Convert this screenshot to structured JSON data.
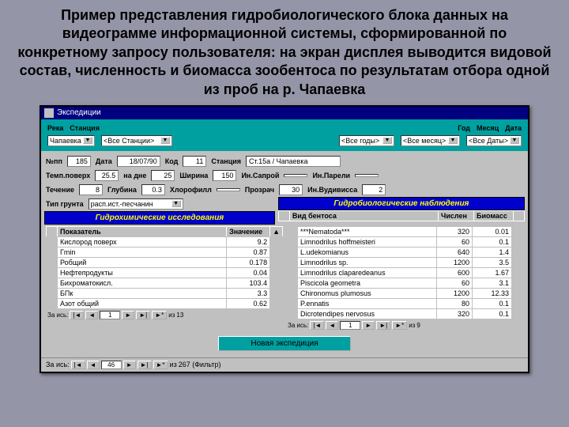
{
  "title": "Пример представления гидробиологического блока данных на видеограмме информационной системы, сформированной по конкретному запросу пользователя: на экран дисплея выводится видовой состав, численность и биомасса зообентоса по результатам отбора одной из проб на р. Чапаевка",
  "window": {
    "title": "Экспедиции"
  },
  "filters": {
    "reka_lbl": "Река",
    "reka_val": "Чапаевка",
    "stanciya_lbl": "Станция",
    "stanciya_val": "<Все Станции>",
    "god_lbl": "Год",
    "god_val": "<Все годы>",
    "mesyac_lbl": "Месяц",
    "mesyac_val": "<Все месяц>",
    "data_lbl": "Дата",
    "data_val": "<Все Даты>"
  },
  "params1": {
    "nrec_lbl": "№пп",
    "nrec": "185",
    "data_lbl": "Дата",
    "data": "18/07/90",
    "kod_lbl": "Код",
    "kod": "11",
    "stanciya_lbl": "Станция",
    "stanciya": "Ст.15а / Чапаевка"
  },
  "params2": {
    "temp_lbl": "Темп.поверх",
    "temp": "25.5",
    "nadne_lbl": "на дне",
    "nadne": "25",
    "shirina_lbl": "Ширина",
    "shirina": "150",
    "in_skoroi_lbl": "Ин.Сапрой",
    "in_sap": "",
    "in_pareli_lbl": "Ин.Парели",
    "in_par": ""
  },
  "params3": {
    "techenie_lbl": "Течение",
    "techenie": "8",
    "glubina_lbl": "Глубина",
    "glubina": "0.3",
    "chlorofill_lbl": "Хлорофилл",
    "chlor": "",
    "prozrach_lbl": "Прозрач",
    "prozrach": "30",
    "in_vud_lbl": "Ин.Вудивисса",
    "in_vud": "2"
  },
  "grunt": {
    "lbl": "Тип грунта",
    "val": "расп.ист.-песчанин"
  },
  "hydro": {
    "hdr_left": "Гидрохимические исследования",
    "hdr_right": "Гидробиологические наблюдения",
    "species_col": "Вид бентоса",
    "count_col": "Числен",
    "biomass_col": "Биомасс"
  },
  "left_table": {
    "col1": "Показатель",
    "col2": "Значение",
    "rows": [
      {
        "p": "Кислород поверх",
        "v": "9.2"
      },
      {
        "p": "Гmin",
        "v": "0.87"
      },
      {
        "p": "Робщий",
        "v": "0.178"
      },
      {
        "p": "Нефтепродукты",
        "v": "0.04"
      },
      {
        "p": "Бихроматокисл.",
        "v": "103.4"
      },
      {
        "p": "БПк",
        "v": "3.3"
      },
      {
        "p": "Азот общий",
        "v": "0.62"
      }
    ]
  },
  "right_table": {
    "rows": [
      {
        "s": "***Nematoda***",
        "c": "320",
        "b": "0.01"
      },
      {
        "s": "Limnodrilus hoffmeisteri",
        "c": "60",
        "b": "0.1"
      },
      {
        "s": "L.udekomianus",
        "c": "640",
        "b": "1.4"
      },
      {
        "s": "Limnodrilus sp.",
        "c": "1200",
        "b": "3.5"
      },
      {
        "s": "Limnodrilus claparedeanus",
        "c": "600",
        "b": "1.67"
      },
      {
        "s": "Piscicola geometra",
        "c": "60",
        "b": "3.1"
      },
      {
        "s": "Chironomus plumosus",
        "c": "1200",
        "b": "12.33"
      },
      {
        "s": "P.ennatis",
        "c": "80",
        "b": "0.1"
      },
      {
        "s": "Dicrotendipes nervosus",
        "c": "320",
        "b": "0.1"
      }
    ]
  },
  "nav": {
    "zapis": "За ись:",
    "iz": "из",
    "left_cur": "1",
    "left_total": "13",
    "right_cur": "1",
    "right_total": "9",
    "main_cur": "46",
    "main_total": "267 (Фильтр)"
  },
  "new_exp": "Новая экспедиция"
}
